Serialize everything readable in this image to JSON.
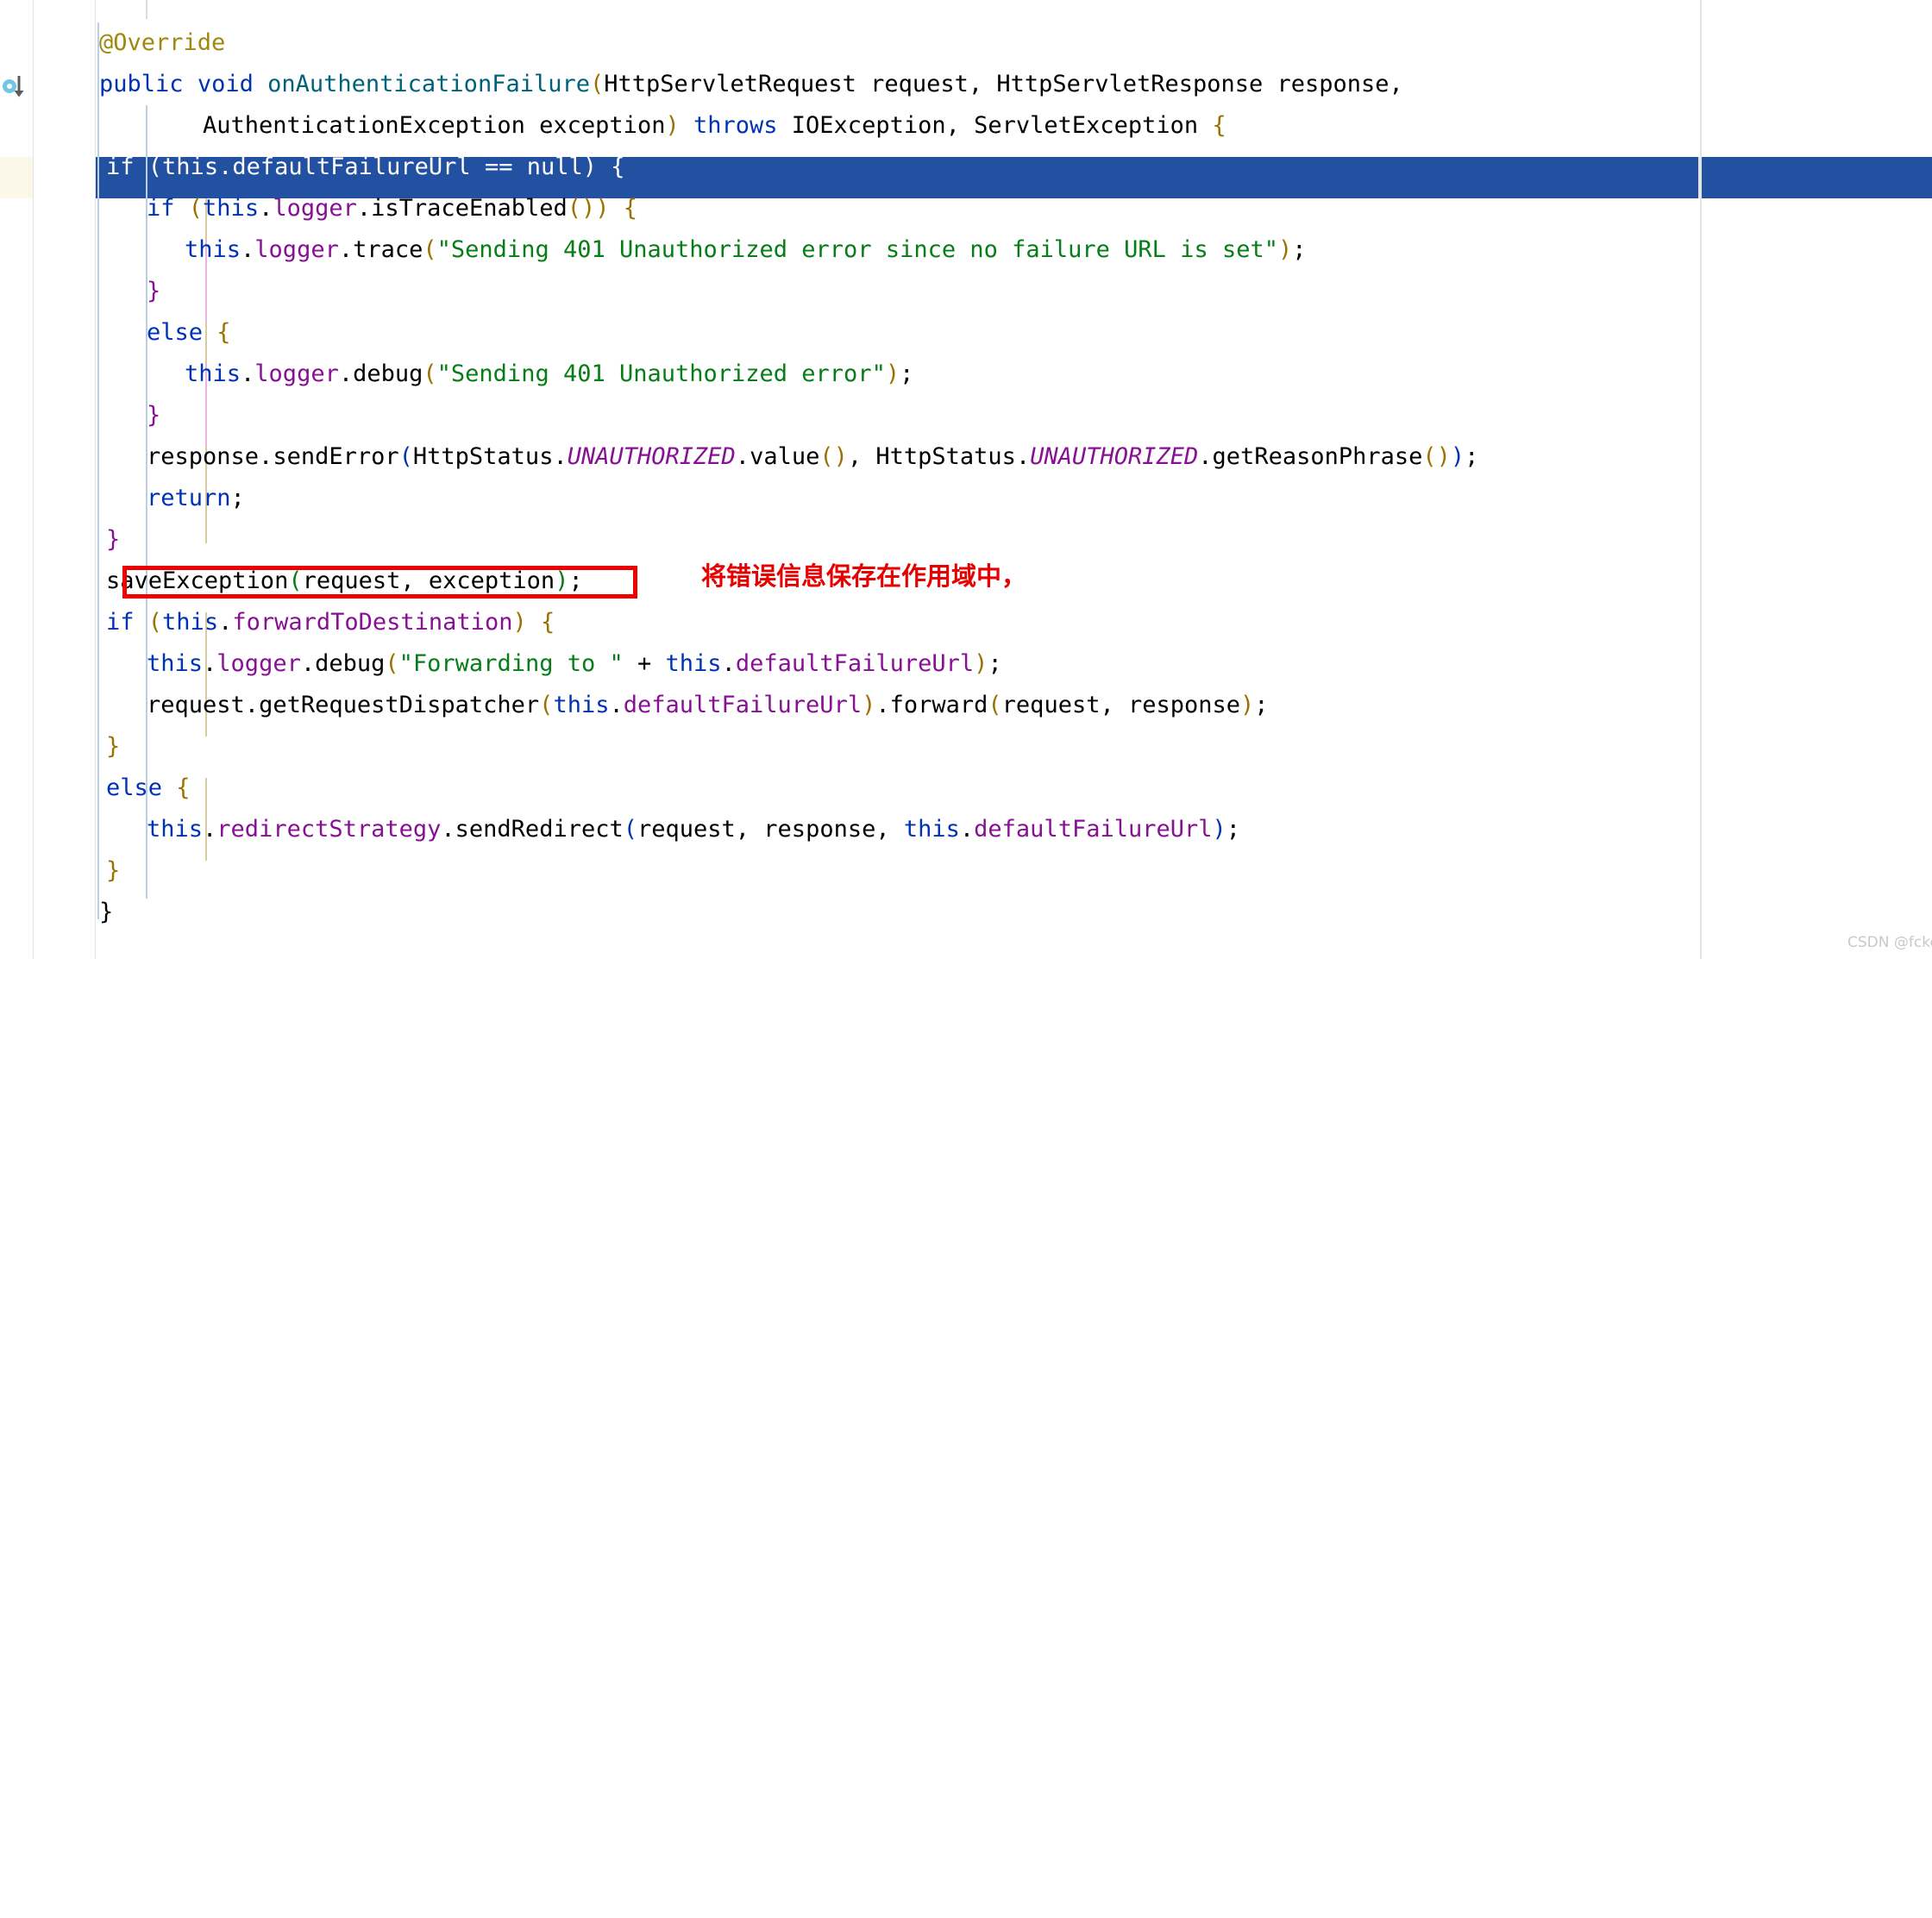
{
  "editor": {
    "language": "java",
    "theme": "IntelliJ Light",
    "caret_line_index": 3,
    "colors": {
      "background": "#ffffff",
      "caret_line_highlight": "#2351A1",
      "caret_line_gutter": "#fbf8e9",
      "keyword": "#0033B3",
      "field": "#871094",
      "string": "#067D17",
      "punctuation": "#9C7101",
      "annotation": "#9E880D",
      "method_declaration": "#00627A",
      "constant": "#871094",
      "indent_guide": "#b8cfe5",
      "annotation_red": "#EC0000",
      "watermark": "#c9c9c9"
    }
  },
  "gutter": {
    "icons": [
      {
        "name": "implementing-method-marker",
        "tooltip": "Implements method in AuthenticationFailureHandler",
        "line_index": 1
      }
    ]
  },
  "code": {
    "lines": [
      {
        "indent": 1,
        "text": "@Override"
      },
      {
        "indent": 1,
        "text": "public void onAuthenticationFailure(HttpServletRequest request, HttpServletResponse response,"
      },
      {
        "indent": 3,
        "text": "AuthenticationException exception) throws IOException, ServletException {"
      },
      {
        "indent": 2,
        "text": "if (this.defaultFailureUrl == null) {"
      },
      {
        "indent": 3,
        "text": "if (this.logger.isTraceEnabled()) {"
      },
      {
        "indent": 4,
        "text": "this.logger.trace(\"Sending 401 Unauthorized error since no failure URL is set\");"
      },
      {
        "indent": 3,
        "text": "}"
      },
      {
        "indent": 3,
        "text": "else {"
      },
      {
        "indent": 4,
        "text": "this.logger.debug(\"Sending 401 Unauthorized error\");"
      },
      {
        "indent": 3,
        "text": "}"
      },
      {
        "indent": 3,
        "text": "response.sendError(HttpStatus.UNAUTHORIZED.value(), HttpStatus.UNAUTHORIZED.getReasonPhrase());"
      },
      {
        "indent": 3,
        "text": "return;"
      },
      {
        "indent": 2,
        "text": "}"
      },
      {
        "indent": 2,
        "text": "saveException(request, exception);"
      },
      {
        "indent": 2,
        "text": "if (this.forwardToDestination) {"
      },
      {
        "indent": 3,
        "text": "this.logger.debug(\"Forwarding to \" + this.defaultFailureUrl);"
      },
      {
        "indent": 3,
        "text": "request.getRequestDispatcher(this.defaultFailureUrl).forward(request, response);"
      },
      {
        "indent": 2,
        "text": "}"
      },
      {
        "indent": 2,
        "text": "else {"
      },
      {
        "indent": 3,
        "text": "this.redirectStrategy.sendRedirect(request, response, this.defaultFailureUrl);"
      },
      {
        "indent": 2,
        "text": "}"
      },
      {
        "indent": 1,
        "text": "}"
      }
    ],
    "tokens": {
      "annotation_override": "@Override",
      "kw_public": "public",
      "kw_void": "void",
      "kw_throws": "throws",
      "kw_if": "if",
      "kw_else": "else",
      "kw_this": "this",
      "kw_null": "null",
      "kw_return": "return",
      "method_name": "onAuthenticationFailure",
      "param_types": [
        "HttpServletRequest",
        "HttpServletResponse",
        "AuthenticationException"
      ],
      "param_names": [
        "request",
        "response",
        "exception"
      ],
      "throws_types": [
        "IOException",
        "ServletException"
      ],
      "string_trace": "\"Sending 401 Unauthorized error since no failure URL is set\"",
      "string_debug": "\"Sending 401 Unauthorized error\"",
      "string_forwarding": "\"Forwarding to \"",
      "constants": [
        "UNAUTHORIZED"
      ],
      "fields": [
        "defaultFailureUrl",
        "logger",
        "forwardToDestination",
        "redirectStrategy"
      ]
    }
  },
  "annotations": {
    "red_box": {
      "name": "save-exception-highlight-box",
      "target_text": "saveException(request, exception);"
    },
    "note_text": "将错误信息保存在作用域中，"
  },
  "watermark": {
    "text": "CSDN @fckey"
  }
}
